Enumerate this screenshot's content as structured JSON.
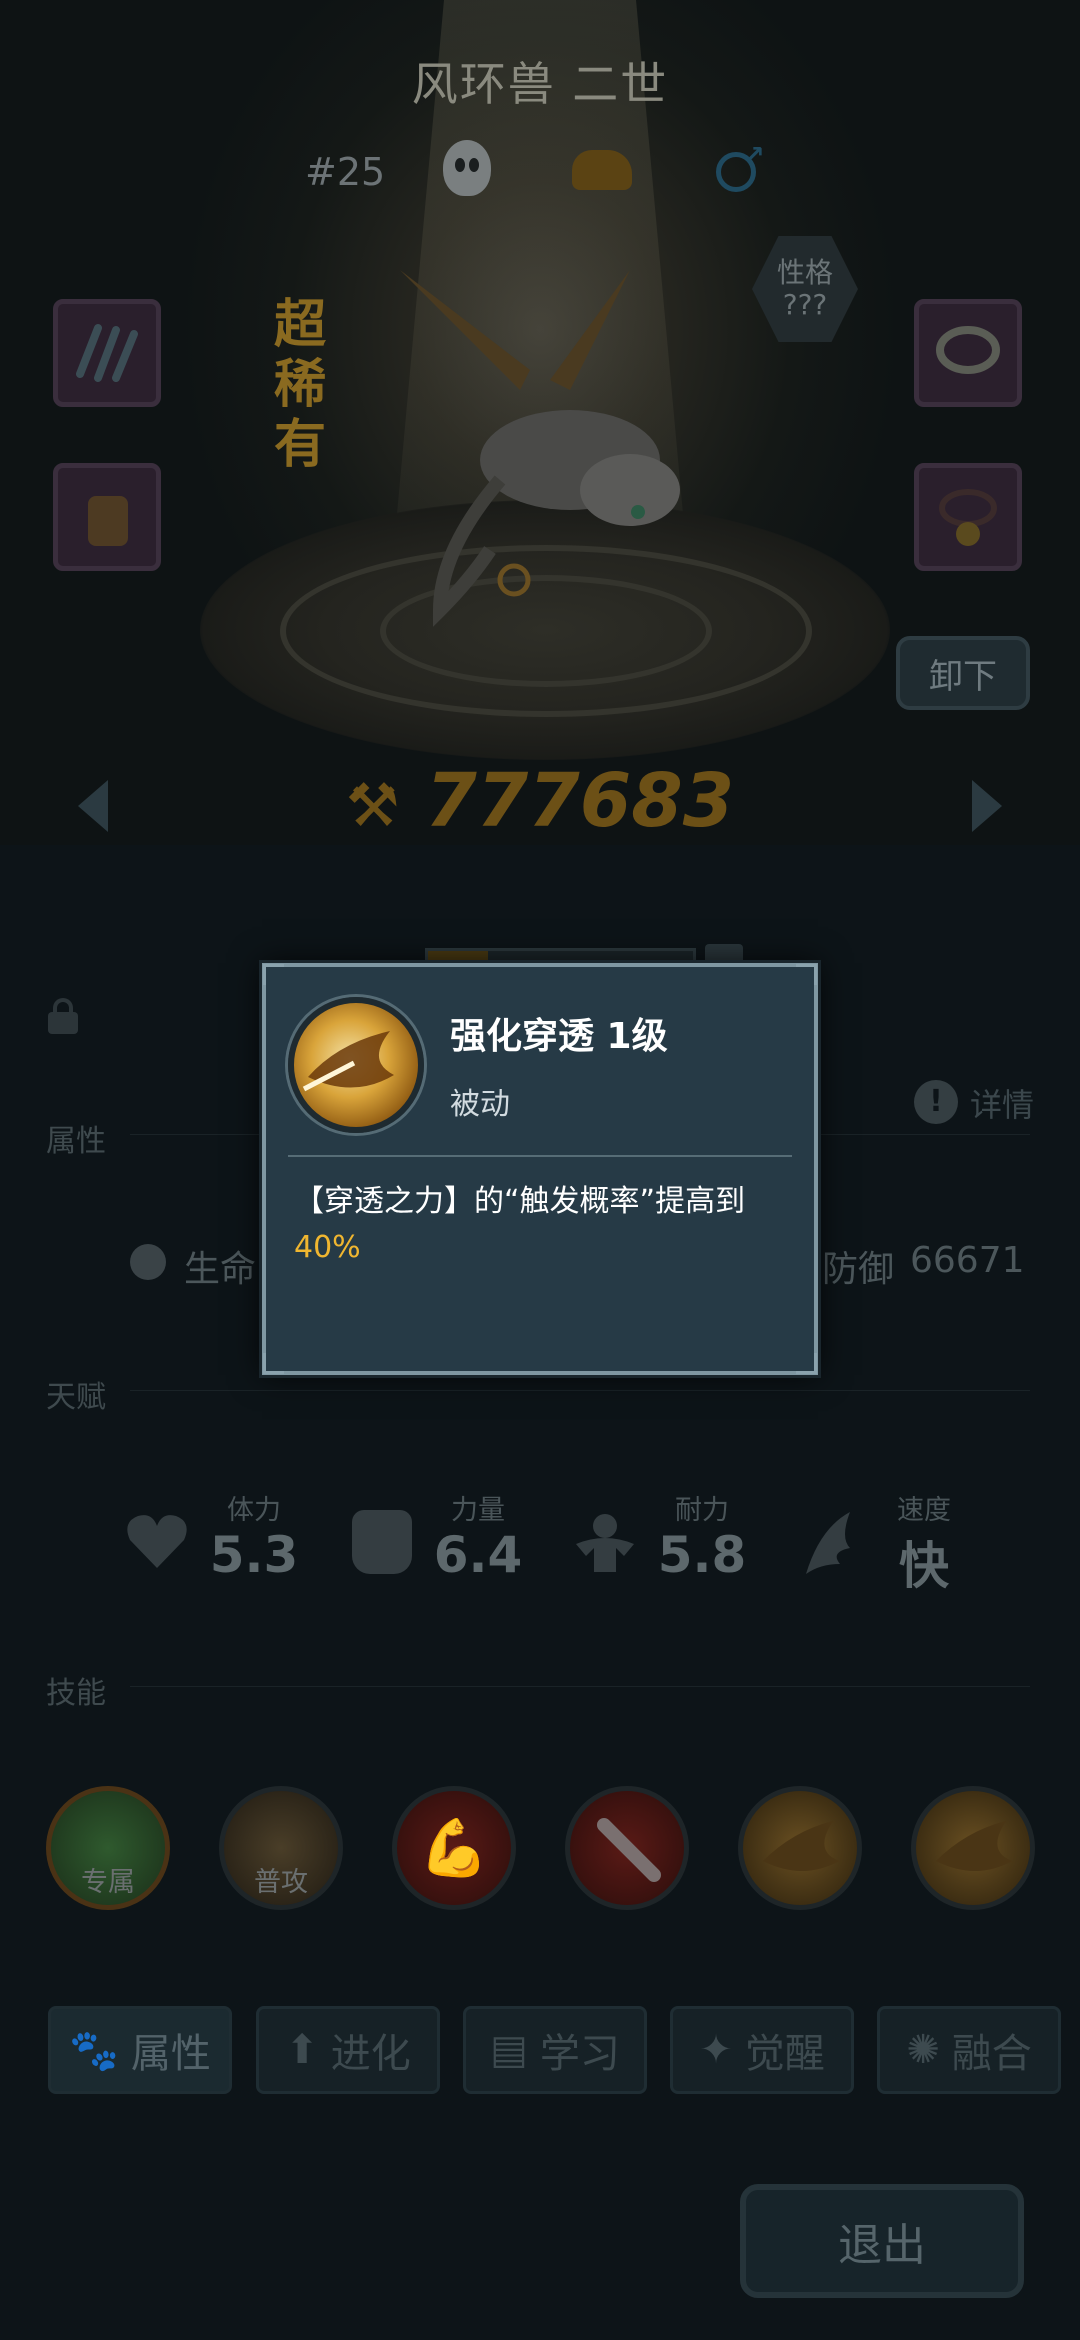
{
  "pet": {
    "name": "风环兽 二世",
    "number": "#25",
    "rarity": "超稀有",
    "trait_label": "性格",
    "trait_value": "???",
    "power": "777683",
    "gender_icon": "male-icon"
  },
  "buttons": {
    "unequip": "卸下",
    "exit": "退出",
    "details": "详情"
  },
  "sections": {
    "attributes": "属性",
    "talents": "天赋",
    "skills": "技能"
  },
  "stats": {
    "life_label": "生命",
    "defense_label": "防御",
    "defense_value": "66671"
  },
  "talents": [
    {
      "label": "体力",
      "value": "5.3",
      "icon": "heart-icon"
    },
    {
      "label": "力量",
      "value": "6.4",
      "icon": "fist-icon"
    },
    {
      "label": "耐力",
      "value": "5.8",
      "icon": "muscle-icon"
    },
    {
      "label": "速度",
      "value": "快",
      "icon": "wing-icon"
    }
  ],
  "skills": [
    {
      "label": "专属",
      "icon": "exclusive-skill-icon",
      "color": "#2f5a2e"
    },
    {
      "label": "普攻",
      "icon": "basic-attack-icon",
      "color": "#3a3020"
    },
    {
      "label": "",
      "icon": "arm-strength-icon",
      "color": "#5a1a16"
    },
    {
      "label": "",
      "icon": "sword-icon",
      "color": "#5a1a16"
    },
    {
      "label": "",
      "icon": "pierce-icon",
      "color": "#6a4a12"
    },
    {
      "label": "",
      "icon": "pierce-icon",
      "color": "#6a4a12"
    }
  ],
  "tabs": [
    {
      "label": "属性",
      "icon": "paw-icon",
      "active": true
    },
    {
      "label": "进化",
      "icon": "evolve-arrow-icon",
      "active": false
    },
    {
      "label": "学习",
      "icon": "book-icon",
      "active": false
    },
    {
      "label": "觉醒",
      "icon": "awaken-icon",
      "active": false
    },
    {
      "label": "融合",
      "icon": "fusion-icon",
      "active": false
    }
  ],
  "dialog": {
    "title": "强化穿透 1级",
    "type": "被动",
    "description": "【穿透之力】的“触发概率”提高到",
    "value": "40%"
  }
}
